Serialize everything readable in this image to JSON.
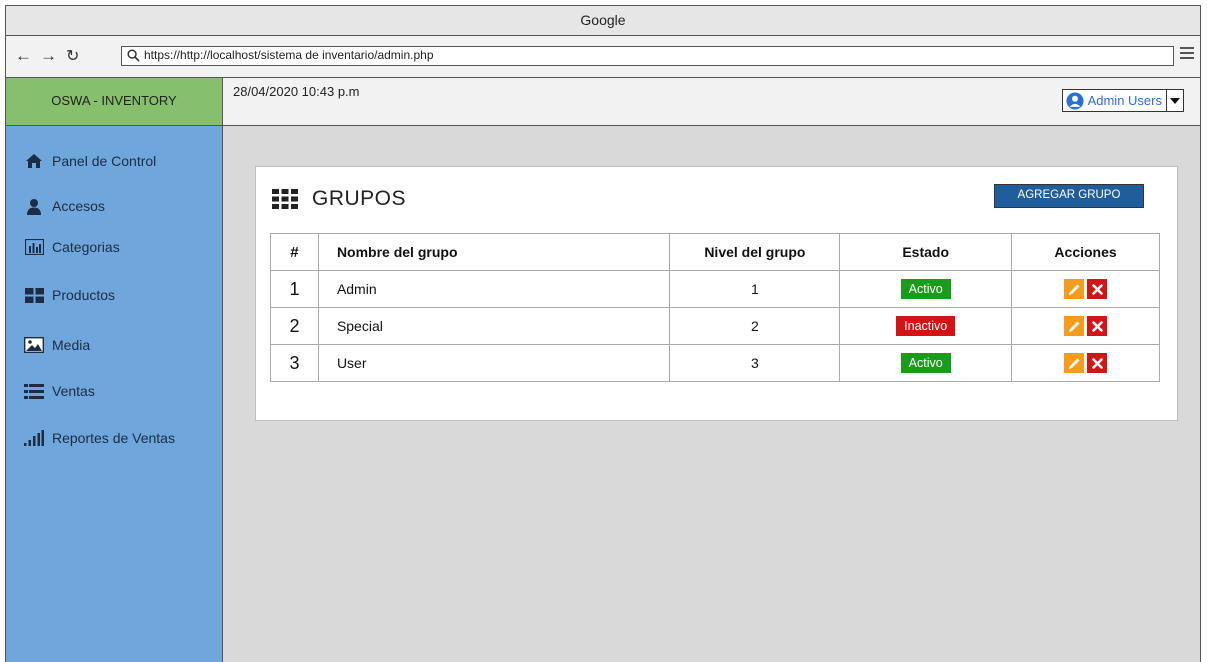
{
  "browser": {
    "title": "Google",
    "url": "https://http://localhost/sistema de inventario/admin.php"
  },
  "app": {
    "brand": "OSWA - INVENTORY",
    "datetime": "28/04/2020 10:43 p.m",
    "user_label": "Admin Users"
  },
  "sidebar": {
    "items": [
      {
        "label": "Panel de Control",
        "icon": "home-icon"
      },
      {
        "label": "Accesos",
        "icon": "user-icon"
      },
      {
        "label": "Categorias",
        "icon": "bar-chart-icon"
      },
      {
        "label": "Productos",
        "icon": "grid-icon"
      },
      {
        "label": "Media",
        "icon": "image-icon"
      },
      {
        "label": "Ventas",
        "icon": "list-icon"
      },
      {
        "label": "Reportes de Ventas",
        "icon": "signal-icon"
      }
    ]
  },
  "panel": {
    "title": "GRUPOS",
    "add_button": "AGREGAR GRUPO",
    "columns": [
      "#",
      "Nombre del grupo",
      "Nivel del grupo",
      "Estado",
      "Acciones"
    ],
    "rows": [
      {
        "num": "1",
        "name": "Admin",
        "level": "1",
        "status": "Activo",
        "status_color": "#1a9c1a"
      },
      {
        "num": "2",
        "name": "Special",
        "level": "2",
        "status": "Inactivo",
        "status_color": "#d41414"
      },
      {
        "num": "3",
        "name": "User",
        "level": "3",
        "status": "Activo",
        "status_color": "#1a9c1a"
      }
    ]
  },
  "colors": {
    "brand_bg": "#86c06c",
    "sidebar_bg": "#6fa7dc",
    "primary_button": "#1f5e9b",
    "edit_button": "#f39c1e",
    "delete_button": "#d41414"
  }
}
